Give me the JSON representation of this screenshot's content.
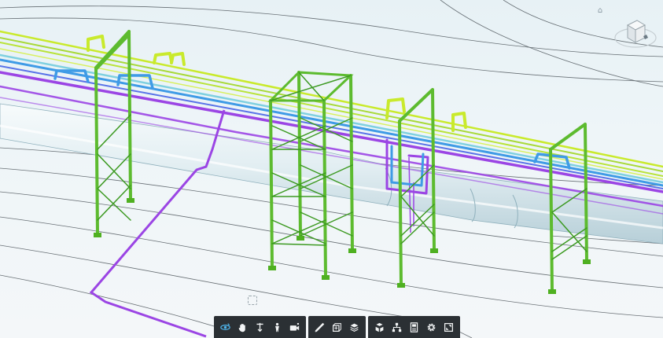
{
  "viewer": {
    "background": "#eaf3f6",
    "colors": {
      "steel": "#5dbb2f",
      "steel_dark": "#2f7d1a",
      "pipe_white": "#dbe9ee",
      "pipe_purple": "#9b45e4",
      "pipe_blue": "#3f9be6",
      "pipe_yellow": "#c9ea2c",
      "pipe_lime": "#a8d93a",
      "pipe_teal": "#7fd0e0",
      "contour": "#3a4248"
    }
  },
  "navigation": {
    "home_icon": "home-icon",
    "view_cube_icon": "view-cube-icon"
  },
  "toolbar": {
    "groups": [
      {
        "name": "navigation",
        "tools": [
          {
            "name": "orbit",
            "icon": "orbit-icon",
            "active": true
          },
          {
            "name": "pan",
            "icon": "hand-icon",
            "active": false
          },
          {
            "name": "zoom",
            "icon": "zoom-icon",
            "active": false
          },
          {
            "name": "first-person",
            "icon": "person-icon",
            "active": false
          },
          {
            "name": "camera",
            "icon": "camera-icon",
            "active": false
          }
        ]
      },
      {
        "name": "analysis",
        "tools": [
          {
            "name": "measure",
            "icon": "ruler-icon",
            "active": false
          },
          {
            "name": "section",
            "icon": "section-box-icon",
            "active": false
          },
          {
            "name": "explode",
            "icon": "layers-icon",
            "active": false
          }
        ]
      },
      {
        "name": "model",
        "tools": [
          {
            "name": "model-browser",
            "icon": "cubes-icon",
            "active": false
          },
          {
            "name": "structure",
            "icon": "hierarchy-icon",
            "active": false
          },
          {
            "name": "properties",
            "icon": "properties-icon",
            "active": false
          },
          {
            "name": "settings",
            "icon": "gear-icon",
            "active": false
          },
          {
            "name": "fullscreen",
            "icon": "fullscreen-icon",
            "active": false
          }
        ]
      }
    ]
  }
}
